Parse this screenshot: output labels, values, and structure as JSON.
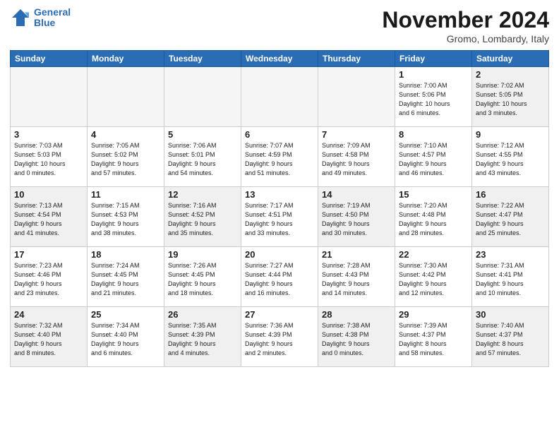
{
  "logo": {
    "line1": "General",
    "line2": "Blue"
  },
  "title": "November 2024",
  "location": "Gromo, Lombardy, Italy",
  "weekdays": [
    "Sunday",
    "Monday",
    "Tuesday",
    "Wednesday",
    "Thursday",
    "Friday",
    "Saturday"
  ],
  "weeks": [
    [
      {
        "day": "",
        "info": ""
      },
      {
        "day": "",
        "info": ""
      },
      {
        "day": "",
        "info": ""
      },
      {
        "day": "",
        "info": ""
      },
      {
        "day": "",
        "info": ""
      },
      {
        "day": "1",
        "info": "Sunrise: 7:00 AM\nSunset: 5:06 PM\nDaylight: 10 hours\nand 6 minutes."
      },
      {
        "day": "2",
        "info": "Sunrise: 7:02 AM\nSunset: 5:05 PM\nDaylight: 10 hours\nand 3 minutes."
      }
    ],
    [
      {
        "day": "3",
        "info": "Sunrise: 7:03 AM\nSunset: 5:03 PM\nDaylight: 10 hours\nand 0 minutes."
      },
      {
        "day": "4",
        "info": "Sunrise: 7:05 AM\nSunset: 5:02 PM\nDaylight: 9 hours\nand 57 minutes."
      },
      {
        "day": "5",
        "info": "Sunrise: 7:06 AM\nSunset: 5:01 PM\nDaylight: 9 hours\nand 54 minutes."
      },
      {
        "day": "6",
        "info": "Sunrise: 7:07 AM\nSunset: 4:59 PM\nDaylight: 9 hours\nand 51 minutes."
      },
      {
        "day": "7",
        "info": "Sunrise: 7:09 AM\nSunset: 4:58 PM\nDaylight: 9 hours\nand 49 minutes."
      },
      {
        "day": "8",
        "info": "Sunrise: 7:10 AM\nSunset: 4:57 PM\nDaylight: 9 hours\nand 46 minutes."
      },
      {
        "day": "9",
        "info": "Sunrise: 7:12 AM\nSunset: 4:55 PM\nDaylight: 9 hours\nand 43 minutes."
      }
    ],
    [
      {
        "day": "10",
        "info": "Sunrise: 7:13 AM\nSunset: 4:54 PM\nDaylight: 9 hours\nand 41 minutes."
      },
      {
        "day": "11",
        "info": "Sunrise: 7:15 AM\nSunset: 4:53 PM\nDaylight: 9 hours\nand 38 minutes."
      },
      {
        "day": "12",
        "info": "Sunrise: 7:16 AM\nSunset: 4:52 PM\nDaylight: 9 hours\nand 35 minutes."
      },
      {
        "day": "13",
        "info": "Sunrise: 7:17 AM\nSunset: 4:51 PM\nDaylight: 9 hours\nand 33 minutes."
      },
      {
        "day": "14",
        "info": "Sunrise: 7:19 AM\nSunset: 4:50 PM\nDaylight: 9 hours\nand 30 minutes."
      },
      {
        "day": "15",
        "info": "Sunrise: 7:20 AM\nSunset: 4:48 PM\nDaylight: 9 hours\nand 28 minutes."
      },
      {
        "day": "16",
        "info": "Sunrise: 7:22 AM\nSunset: 4:47 PM\nDaylight: 9 hours\nand 25 minutes."
      }
    ],
    [
      {
        "day": "17",
        "info": "Sunrise: 7:23 AM\nSunset: 4:46 PM\nDaylight: 9 hours\nand 23 minutes."
      },
      {
        "day": "18",
        "info": "Sunrise: 7:24 AM\nSunset: 4:45 PM\nDaylight: 9 hours\nand 21 minutes."
      },
      {
        "day": "19",
        "info": "Sunrise: 7:26 AM\nSunset: 4:45 PM\nDaylight: 9 hours\nand 18 minutes."
      },
      {
        "day": "20",
        "info": "Sunrise: 7:27 AM\nSunset: 4:44 PM\nDaylight: 9 hours\nand 16 minutes."
      },
      {
        "day": "21",
        "info": "Sunrise: 7:28 AM\nSunset: 4:43 PM\nDaylight: 9 hours\nand 14 minutes."
      },
      {
        "day": "22",
        "info": "Sunrise: 7:30 AM\nSunset: 4:42 PM\nDaylight: 9 hours\nand 12 minutes."
      },
      {
        "day": "23",
        "info": "Sunrise: 7:31 AM\nSunset: 4:41 PM\nDaylight: 9 hours\nand 10 minutes."
      }
    ],
    [
      {
        "day": "24",
        "info": "Sunrise: 7:32 AM\nSunset: 4:40 PM\nDaylight: 9 hours\nand 8 minutes."
      },
      {
        "day": "25",
        "info": "Sunrise: 7:34 AM\nSunset: 4:40 PM\nDaylight: 9 hours\nand 6 minutes."
      },
      {
        "day": "26",
        "info": "Sunrise: 7:35 AM\nSunset: 4:39 PM\nDaylight: 9 hours\nand 4 minutes."
      },
      {
        "day": "27",
        "info": "Sunrise: 7:36 AM\nSunset: 4:39 PM\nDaylight: 9 hours\nand 2 minutes."
      },
      {
        "day": "28",
        "info": "Sunrise: 7:38 AM\nSunset: 4:38 PM\nDaylight: 9 hours\nand 0 minutes."
      },
      {
        "day": "29",
        "info": "Sunrise: 7:39 AM\nSunset: 4:37 PM\nDaylight: 8 hours\nand 58 minutes."
      },
      {
        "day": "30",
        "info": "Sunrise: 7:40 AM\nSunset: 4:37 PM\nDaylight: 8 hours\nand 57 minutes."
      }
    ]
  ]
}
